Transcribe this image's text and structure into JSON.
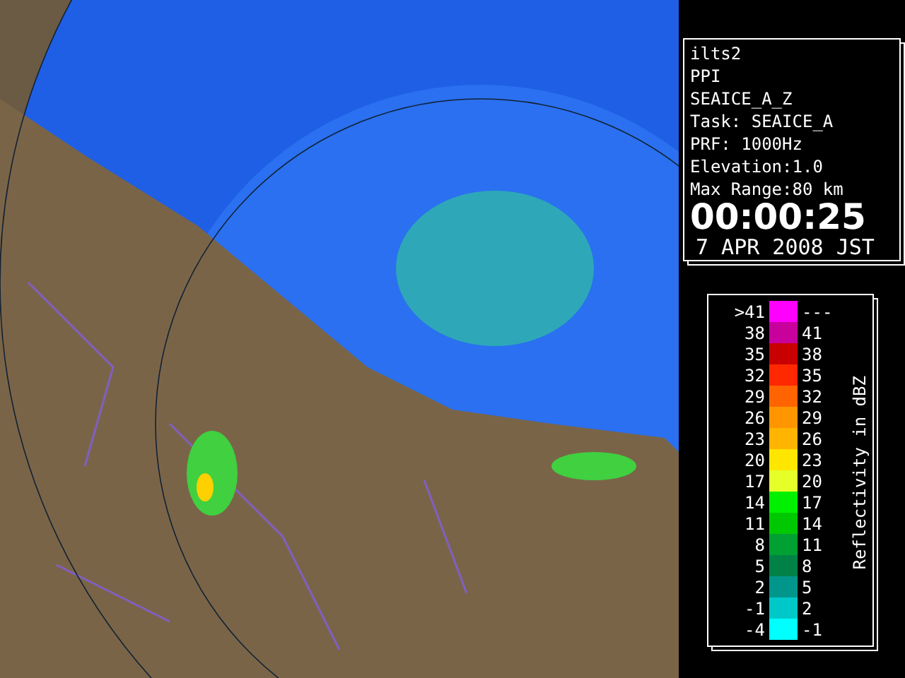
{
  "info_panel": {
    "lines": [
      "ilts2",
      "PPI",
      "SEAICE_A_Z",
      "Task: SEAICE_A",
      "PRF: 1000Hz",
      "Elevation:1.0",
      "Max Range:80 km"
    ],
    "time": "00:00:25",
    "date": "7 APR 2008 JST"
  },
  "legend": {
    "title": "Reflectivity in dBZ",
    "rows": [
      {
        "low": ">41",
        "high": "---",
        "color": "#ff00ff"
      },
      {
        "low": "38",
        "high": "41",
        "color": "#c8009c"
      },
      {
        "low": "35",
        "high": "38",
        "color": "#c80000"
      },
      {
        "low": "32",
        "high": "35",
        "color": "#ff2800"
      },
      {
        "low": "29",
        "high": "32",
        "color": "#ff6400"
      },
      {
        "low": "26",
        "high": "29",
        "color": "#ff9600"
      },
      {
        "low": "23",
        "high": "26",
        "color": "#ffb400"
      },
      {
        "low": "20",
        "high": "23",
        "color": "#ffe600"
      },
      {
        "low": "17",
        "high": "20",
        "color": "#e6ff28"
      },
      {
        "low": "14",
        "high": "17",
        "color": "#00f000"
      },
      {
        "low": "11",
        "high": "14",
        "color": "#00c800"
      },
      {
        "low": "8",
        "high": "11",
        "color": "#00a032"
      },
      {
        "low": "5",
        "high": "8",
        "color": "#008246"
      },
      {
        "low": "2",
        "high": "5",
        "color": "#00968c"
      },
      {
        "low": "-1",
        "high": "2",
        "color": "#00c8c8"
      },
      {
        "low": "-4",
        "high": "-1",
        "color": "#00ffff"
      }
    ]
  }
}
